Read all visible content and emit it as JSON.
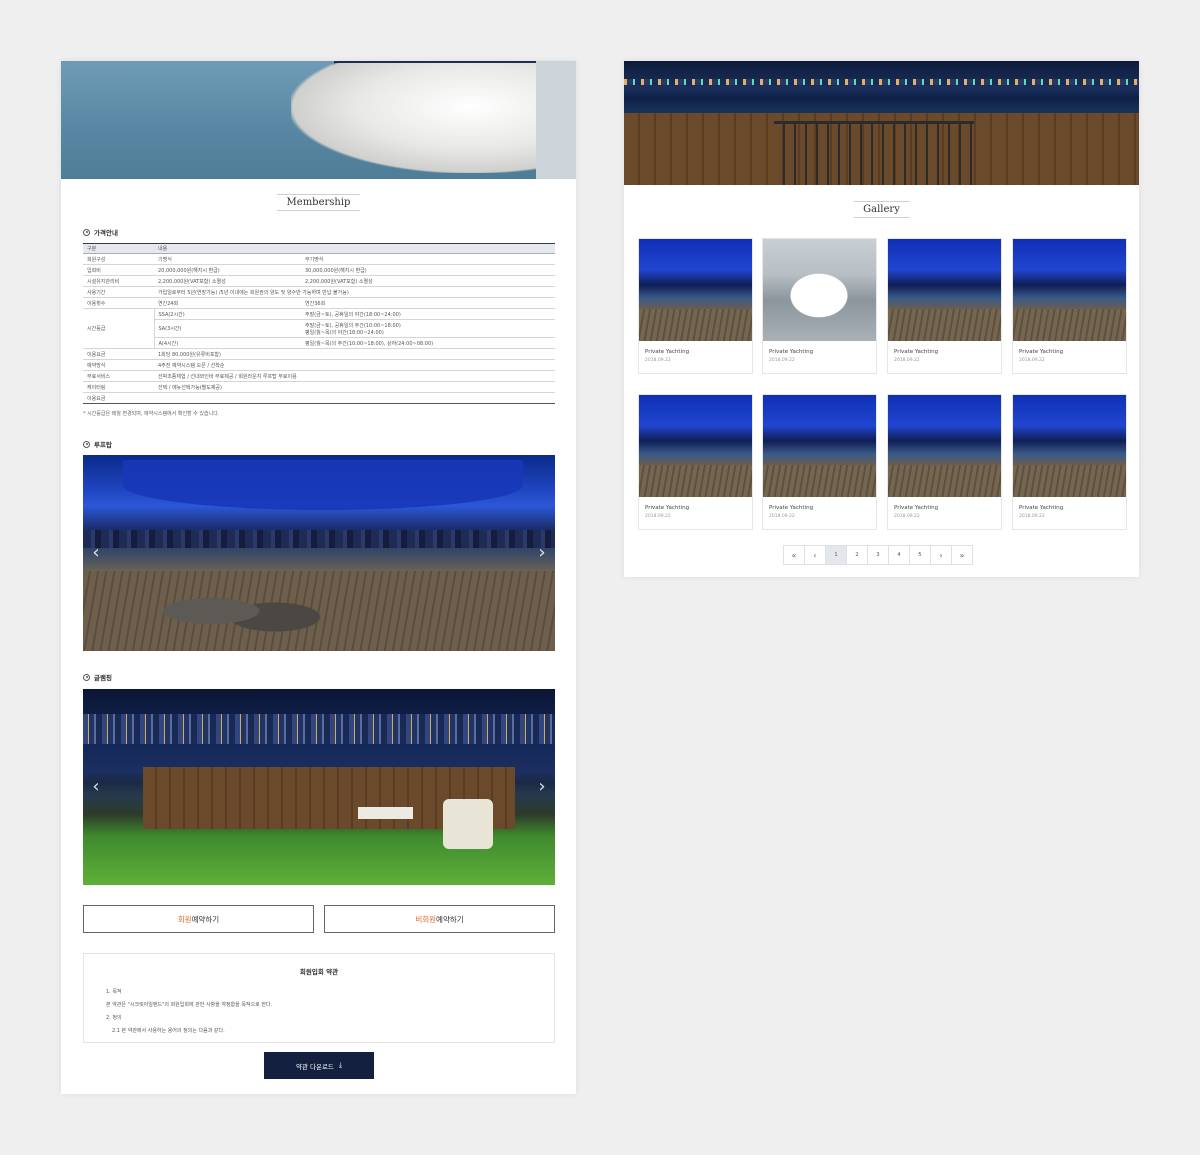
{
  "membership": {
    "title": "Membership",
    "price_section": "가격안내",
    "table_header": [
      "구분",
      "내용"
    ],
    "rows": {
      "r1": [
        "회원구성",
        "기명식",
        "무기명식"
      ],
      "r2": [
        "입회비",
        "20,000,000원(해지시 환급)",
        "30,000,000원(해지시 환급)"
      ],
      "r3": [
        "시설유지관리비",
        "2,200,000원(VAT포함) 소멸성",
        "2,200,000원(VAT포함) 소멸성"
      ],
      "r4": [
        "사용기간",
        "가입일로부터 5년(연장가능) /5년 이내에는 회원권의 양도 및 양수만 가능하며 반납 불가능)"
      ],
      "r5": [
        "이용횟수",
        "연간24회",
        "연간36회"
      ],
      "r6_label": "시간등급",
      "r6a": [
        "SSA(2시간)",
        "주말(금~토), 공휴일의 야간(18:00~24:00)"
      ],
      "r6b": [
        "SA(3시간)",
        "주말(금~토), 공휴일의 주간(10:00~18:00)",
        "평일(월~목)의 야간(18:00~24:00)"
      ],
      "r6c": [
        "A(4시간)",
        "평일(월~목)의 주간(10:00~18:00), 상하(24:00~08:00)"
      ],
      "r7": [
        "이용요금",
        "1회당 80,000원(유류비포함)"
      ],
      "r8": [
        "예약방식",
        "4주전 예약시스템 오픈 / 선착순"
      ],
      "r9": [
        "무료서비스",
        "선박조종체험 / 선내와인바 무료제공 / 회원라운지 루프탑 무료이용"
      ],
      "r10": [
        "케이터링",
        "선택 / 메뉴선택가능(별도제공)"
      ],
      "r11": [
        "이용요금",
        ""
      ]
    },
    "note": "* 시간등급은 매월 변경되며, 예약시스템에서 확인할 수 있습니다.",
    "rooftop_section": "루프탑",
    "glamping_section": "글램핑",
    "arrow_prev": "‹",
    "arrow_next": "›",
    "btn_member_hl": "회원",
    "btn_member_rest": "예약하기",
    "btn_nonmember_hl": "비회원",
    "btn_nonmember_rest": "예약하기",
    "terms": {
      "title": "회원입회 약관",
      "p1": "1. 목적",
      "p2": "본 약관은 \"시크릿아일랜드\"의 회원입회에 관한 사항을 약정함을 목적으로 한다.",
      "p3": "2. 정의",
      "p4": "2.1 본 약관에서 사용하는 용어의 정의는 다음과 같다."
    },
    "download_label": "약관 다운로드",
    "download_icon": "⤓"
  },
  "gallery": {
    "title": "Gallery",
    "items": [
      {
        "title": "Private Yachting",
        "date": "2018.09.22"
      },
      {
        "title": "Private Yachting",
        "date": "2018.09.22"
      },
      {
        "title": "Private Yachting",
        "date": "2018.09.22"
      },
      {
        "title": "Private Yachting",
        "date": "2018.09.22"
      },
      {
        "title": "Private Yachting",
        "date": "2018.09.22"
      },
      {
        "title": "Private Yachting",
        "date": "2018.09.22"
      },
      {
        "title": "Private Yachting",
        "date": "2018.09.22"
      },
      {
        "title": "Private Yachting",
        "date": "2018.09.22"
      }
    ],
    "pager": {
      "first": "«",
      "prev": "‹",
      "pages": [
        "1",
        "2",
        "3",
        "4",
        "5"
      ],
      "next": "›",
      "last": "»",
      "active": "1"
    }
  }
}
